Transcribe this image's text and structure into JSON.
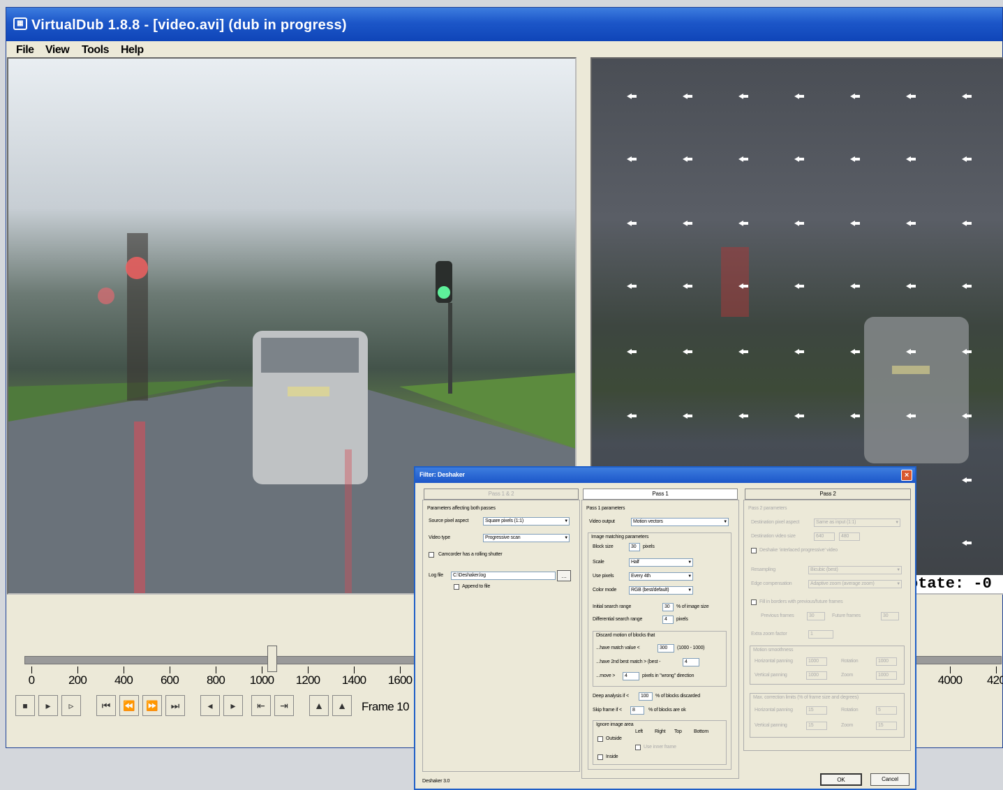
{
  "window": {
    "title": "VirtualDub 1.8.8 - [video.avi] (dub in progress)",
    "icon": "virtualdub-icon"
  },
  "menu": [
    "File",
    "View",
    "Tools",
    "Help"
  ],
  "overlay_text": "otate: -0",
  "timeline": {
    "ticks": [
      "0",
      "200",
      "400",
      "600",
      "800",
      "1000",
      "1200",
      "1400",
      "1600",
      "4000",
      "420"
    ],
    "position_fraction": 0.241
  },
  "toolbar": {
    "frame_label": "Frame 10"
  },
  "dialog": {
    "title": "Filter: Deshaker",
    "close": "×",
    "tabs": [
      "Pass 1 & 2",
      "Pass 1",
      "Pass 2"
    ],
    "col1": {
      "group": "Parameters affecting both passes",
      "source_pixel_aspect_label": "Source pixel aspect",
      "source_pixel_aspect_value": "Square pixels (1:1)",
      "video_type_label": "Video type",
      "video_type_value": "Progressive scan",
      "rolling_shutter": "Camcorder has a rolling shutter",
      "log_file_label": "Log file",
      "log_file_value": "C:\\Deshaker.log",
      "append_to_file": "Append to file"
    },
    "col2": {
      "group": "Pass 1 parameters",
      "video_output_label": "Video output",
      "video_output_value": "Motion vectors",
      "matching_group": "Image matching parameters",
      "block_size_label": "Block size",
      "block_size_value": "30",
      "block_size_unit": "pixels",
      "scale_label": "Scale",
      "scale_value": "Half",
      "use_pixels_label": "Use pixels",
      "use_pixels_value": "Every 4th",
      "color_mode_label": "Color mode",
      "color_mode_value": "RGB (best/default)",
      "initial_search_label": "Initial search range",
      "initial_search_value": "30",
      "initial_search_unit": "% of image size",
      "diff_search_label": "Differential search range",
      "diff_search_value": "4",
      "diff_search_unit": "pixels",
      "discard_group": "Discard motion of blocks that",
      "discard_match_label": "...have match value <",
      "discard_match_value": "300",
      "discard_match_unit": "(1000 - 1000)",
      "discard_2nd_label": "...have 2nd best match > (best -",
      "discard_2nd_value": "4",
      "discard_moved_label": "...move >",
      "discard_moved_value": "4",
      "discard_moved_unit": "pixels in \"wrong\" direction",
      "deep_analysis_label": "Deep analysis if <",
      "deep_analysis_value": "100",
      "deep_analysis_unit": "% of blocks discarded",
      "skip_frame_label": "Skip frame if <",
      "skip_frame_value": "8",
      "skip_frame_unit": "% of blocks are ok",
      "ignore_group": "Ignore image area",
      "ignore_cols": [
        "Left",
        "Right",
        "Top",
        "Bottom"
      ],
      "outside_label": "Outside",
      "inside_label": "Inside",
      "use_inner_label": "Use inner frame"
    },
    "col3": {
      "group": "Pass 2 parameters",
      "dest_pixel_aspect_label": "Destination pixel aspect",
      "dest_pixel_aspect_value": "Same as input (1:1)",
      "dest_video_size_label": "Destination video size",
      "dest_w": "640",
      "dest_h": "480",
      "interlaced_label": "Deshake ‘interlaced progressive’ video",
      "resampling_label": "Resampling",
      "resampling_value": "Bicubic (best)",
      "edge_label": "Edge compensation",
      "edge_value": "Adaptive zoom (average zoom)",
      "previous_label": "Fill in borders with previous/future frames",
      "prev_frames_label": "Previous frames",
      "prev_frames_value": "30",
      "future_frames_label": "Future frames",
      "future_frames_value": "30",
      "frames_to_label": "Extra zoom factor",
      "frames_to_value": "1",
      "motion_smooth_group": "Motion smoothness",
      "horiz_panning": "Horizontal panning",
      "horiz_panning_value": "1000",
      "rotation": "Rotation",
      "rotation_value": "1000",
      "vert_panning": "Vertical panning",
      "vert_panning_value": "1000",
      "zoom": "Zoom",
      "zoom_value": "1000",
      "max_correction_group": "Max. correction limits (% of frame size and degrees)",
      "horiz_limit": "Horizontal panning",
      "horiz_limit_value": "15",
      "rot_limit": "Rotation",
      "rot_limit_value": "5",
      "vert_limit": "Vertical panning",
      "vert_limit_value": "15",
      "zoom_limit": "Zoom",
      "zoom_limit_value": "15"
    },
    "footer": "Deshaker 3.0",
    "ok": "OK",
    "cancel": "Cancel"
  }
}
